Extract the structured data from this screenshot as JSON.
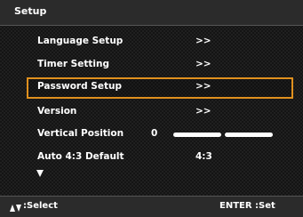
{
  "title": "Setup",
  "menu": [
    {
      "label": "Language Setup",
      "value": ">>"
    },
    {
      "label": "Timer Setting",
      "value": ">>"
    },
    {
      "label": "Password Setup",
      "value": ">>",
      "selected": true
    },
    {
      "label": "Version",
      "value": ">>"
    },
    {
      "label": "Vertical Position",
      "value": "0"
    },
    {
      "label": "Auto 4:3 Default",
      "value": "4:3"
    }
  ],
  "footer": {
    "select_hint": ":Select",
    "enter_hint": "ENTER :Set"
  },
  "colors": {
    "highlight": "#e0901e",
    "bar": "#2b2b2b",
    "text": "#ffffff"
  },
  "icons": {
    "more": "down-triangle-icon",
    "navigate": "up-down-arrows-icon"
  }
}
